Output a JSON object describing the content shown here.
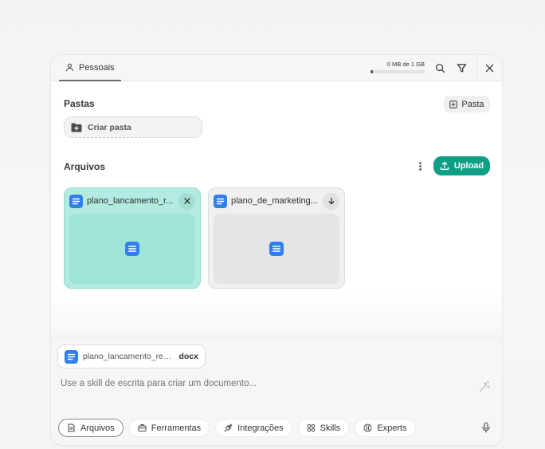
{
  "topbar": {
    "tab_label": "Pessoais",
    "storage_text": "0 MB de 1 GB",
    "storage_used_fraction": 0.0,
    "icons": [
      "search-icon",
      "filter-icon",
      "close-icon"
    ]
  },
  "folders": {
    "title": "Pastas",
    "new_folder_button": "Pasta",
    "create_folder_label": "Criar pasta"
  },
  "files": {
    "title": "Arquivos",
    "upload_label": "Upload",
    "items": [
      {
        "name": "plano_lancamento_r...",
        "selected": true,
        "action_icon": "close-icon"
      },
      {
        "name": "plano_de_marketing...",
        "selected": false,
        "action_icon": "arrow-down-icon"
      }
    ]
  },
  "composer": {
    "attachment_name": "plano_lancamento_reg...",
    "attachment_ext": "docx",
    "placeholder": "Use a skill de escrita para criar um documento...",
    "chips": [
      {
        "label": "Arquivos",
        "icon": "document-icon",
        "active": true
      },
      {
        "label": "Ferramentas",
        "icon": "toolbox-icon",
        "active": false
      },
      {
        "label": "Integrações",
        "icon": "plug-icon",
        "active": false
      },
      {
        "label": "Skills",
        "icon": "grid-dots-icon",
        "active": false
      },
      {
        "label": "Experts",
        "icon": "globe-icon",
        "active": false
      }
    ]
  },
  "colors": {
    "accent": "#0f9e86",
    "selected_card": "#b3ebe1",
    "doc_icon": "#2f80ed"
  }
}
